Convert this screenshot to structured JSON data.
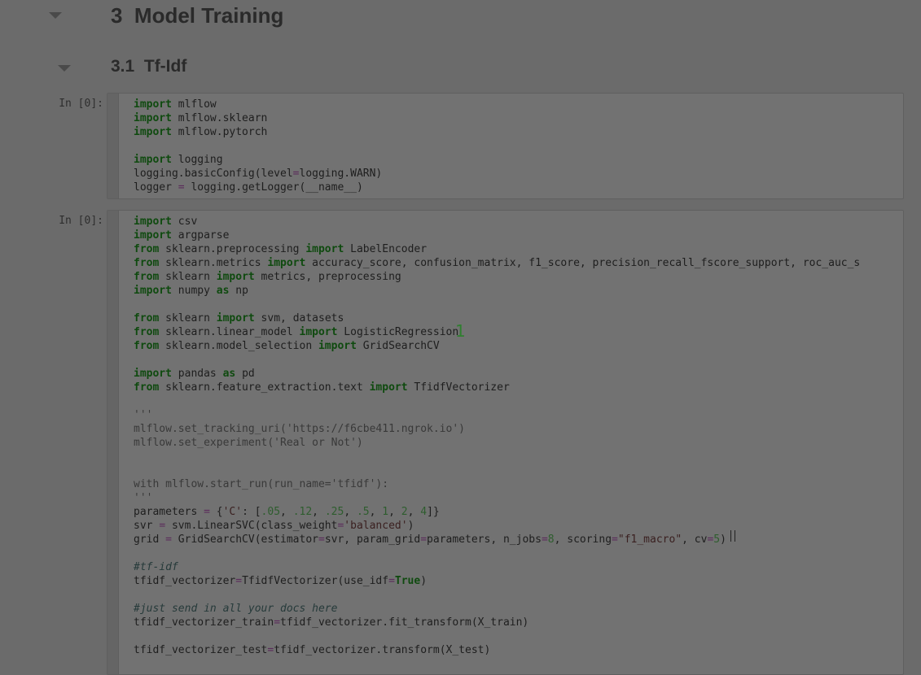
{
  "headings": {
    "h1": "3  Model Training",
    "h2": "3.1  Tf-Idf"
  },
  "cells": [
    {
      "prompt": "In [0]:",
      "lines": [
        [
          {
            "t": "kw",
            "v": "import"
          },
          {
            "t": "",
            "v": " mlflow"
          }
        ],
        [
          {
            "t": "kw",
            "v": "import"
          },
          {
            "t": "",
            "v": " mlflow.sklearn"
          }
        ],
        [
          {
            "t": "kw",
            "v": "import"
          },
          {
            "t": "",
            "v": " mlflow.pytorch"
          }
        ],
        [],
        [
          {
            "t": "kw",
            "v": "import"
          },
          {
            "t": "",
            "v": " logging"
          }
        ],
        [
          {
            "t": "",
            "v": "logging.basicConfig(level"
          },
          {
            "t": "op",
            "v": "="
          },
          {
            "t": "",
            "v": "logging.WARN)"
          }
        ],
        [
          {
            "t": "",
            "v": "logger "
          },
          {
            "t": "op",
            "v": "="
          },
          {
            "t": "",
            "v": " logging.getLogger(__name__)"
          }
        ]
      ]
    },
    {
      "prompt": "In [0]:",
      "lines": [
        [
          {
            "t": "kw",
            "v": "import"
          },
          {
            "t": "",
            "v": " csv"
          }
        ],
        [
          {
            "t": "kw",
            "v": "import"
          },
          {
            "t": "",
            "v": " argparse"
          }
        ],
        [
          {
            "t": "kw",
            "v": "from"
          },
          {
            "t": "",
            "v": " sklearn.preprocessing "
          },
          {
            "t": "kw",
            "v": "import"
          },
          {
            "t": "",
            "v": " LabelEncoder"
          }
        ],
        [
          {
            "t": "kw",
            "v": "from"
          },
          {
            "t": "",
            "v": " sklearn.metrics "
          },
          {
            "t": "kw",
            "v": "import"
          },
          {
            "t": "",
            "v": " accuracy_score, confusion_matrix, f1_score, precision_recall_fscore_support, roc_auc_s"
          }
        ],
        [
          {
            "t": "kw",
            "v": "from"
          },
          {
            "t": "",
            "v": " sklearn "
          },
          {
            "t": "kw",
            "v": "import"
          },
          {
            "t": "",
            "v": " metrics, preprocessing"
          }
        ],
        [
          {
            "t": "kw",
            "v": "import"
          },
          {
            "t": "",
            "v": " numpy "
          },
          {
            "t": "kw",
            "v": "as"
          },
          {
            "t": "",
            "v": " np"
          }
        ],
        [],
        [
          {
            "t": "kw",
            "v": "from"
          },
          {
            "t": "",
            "v": " sklearn "
          },
          {
            "t": "kw",
            "v": "import"
          },
          {
            "t": "",
            "v": " svm, datasets"
          }
        ],
        [
          {
            "t": "kw",
            "v": "from"
          },
          {
            "t": "",
            "v": " sklearn.linear_model "
          },
          {
            "t": "kw",
            "v": "import"
          },
          {
            "t": "",
            "v": " LogisticRegression"
          }
        ],
        [
          {
            "t": "kw",
            "v": "from"
          },
          {
            "t": "",
            "v": " sklearn.model_selection "
          },
          {
            "t": "kw",
            "v": "import"
          },
          {
            "t": "",
            "v": " GridSearchCV"
          }
        ],
        [],
        [
          {
            "t": "kw",
            "v": "import"
          },
          {
            "t": "",
            "v": " pandas "
          },
          {
            "t": "kw",
            "v": "as"
          },
          {
            "t": "",
            "v": " pd"
          }
        ],
        [
          {
            "t": "kw",
            "v": "from"
          },
          {
            "t": "",
            "v": " sklearn.feature_extraction.text "
          },
          {
            "t": "kw",
            "v": "import"
          },
          {
            "t": "",
            "v": " TfidfVectorizer"
          }
        ],
        [],
        [
          {
            "t": "ds",
            "v": "'''"
          }
        ],
        [
          {
            "t": "ds",
            "v": "mlflow.set_tracking_uri('https://f6cbe411.ngrok.io')"
          }
        ],
        [
          {
            "t": "ds",
            "v": "mlflow.set_experiment('Real or Not')"
          }
        ],
        [],
        [],
        [
          {
            "t": "ds",
            "v": "with mlflow.start_run(run_name='tfidf'):"
          }
        ],
        [
          {
            "t": "ds",
            "v": "'''"
          }
        ],
        [
          {
            "t": "",
            "v": "parameters "
          },
          {
            "t": "op",
            "v": "="
          },
          {
            "t": "",
            "v": " {"
          },
          {
            "t": "str",
            "v": "'C'"
          },
          {
            "t": "",
            "v": ": ["
          },
          {
            "t": "num",
            "v": ".05"
          },
          {
            "t": "",
            "v": ", "
          },
          {
            "t": "num",
            "v": ".12"
          },
          {
            "t": "",
            "v": ", "
          },
          {
            "t": "num",
            "v": ".25"
          },
          {
            "t": "",
            "v": ", "
          },
          {
            "t": "num",
            "v": ".5"
          },
          {
            "t": "",
            "v": ", "
          },
          {
            "t": "num",
            "v": "1"
          },
          {
            "t": "",
            "v": ", "
          },
          {
            "t": "num",
            "v": "2"
          },
          {
            "t": "",
            "v": ", "
          },
          {
            "t": "num",
            "v": "4"
          },
          {
            "t": "",
            "v": "]}"
          }
        ],
        [
          {
            "t": "",
            "v": "svr "
          },
          {
            "t": "op",
            "v": "="
          },
          {
            "t": "",
            "v": " svm.LinearSVC(class_weight"
          },
          {
            "t": "op",
            "v": "="
          },
          {
            "t": "str",
            "v": "'balanced'"
          },
          {
            "t": "",
            "v": ")"
          }
        ],
        [
          {
            "t": "",
            "v": "grid "
          },
          {
            "t": "op",
            "v": "="
          },
          {
            "t": "",
            "v": " GridSearchCV(estimator"
          },
          {
            "t": "op",
            "v": "="
          },
          {
            "t": "",
            "v": "svr, param_grid"
          },
          {
            "t": "op",
            "v": "="
          },
          {
            "t": "",
            "v": "parameters, n_jobs"
          },
          {
            "t": "op",
            "v": "="
          },
          {
            "t": "num",
            "v": "8"
          },
          {
            "t": "",
            "v": ", scoring"
          },
          {
            "t": "op",
            "v": "="
          },
          {
            "t": "str",
            "v": "\"f1_macro\""
          },
          {
            "t": "",
            "v": ", cv"
          },
          {
            "t": "op",
            "v": "="
          },
          {
            "t": "num",
            "v": "5"
          },
          {
            "t": "",
            "v": ")"
          }
        ],
        [],
        [
          {
            "t": "cm",
            "v": "#tf-idf"
          }
        ],
        [
          {
            "t": "",
            "v": "tfidf_vectorizer"
          },
          {
            "t": "op",
            "v": "="
          },
          {
            "t": "",
            "v": "TfidfVectorizer(use_idf"
          },
          {
            "t": "op",
            "v": "="
          },
          {
            "t": "kc",
            "v": "True"
          },
          {
            "t": "",
            "v": ")"
          }
        ],
        [],
        [
          {
            "t": "cm",
            "v": "#just send in all your docs here"
          }
        ],
        [
          {
            "t": "",
            "v": "tfidf_vectorizer_train"
          },
          {
            "t": "op",
            "v": "="
          },
          {
            "t": "",
            "v": "tfidf_vectorizer.fit_transform(X_train)"
          }
        ],
        [],
        [
          {
            "t": "",
            "v": "tfidf_vectorizer_test"
          },
          {
            "t": "op",
            "v": "="
          },
          {
            "t": "",
            "v": "tfidf_vectorizer.transform(X_test)"
          }
        ]
      ]
    }
  ],
  "overlay_marker": "1"
}
